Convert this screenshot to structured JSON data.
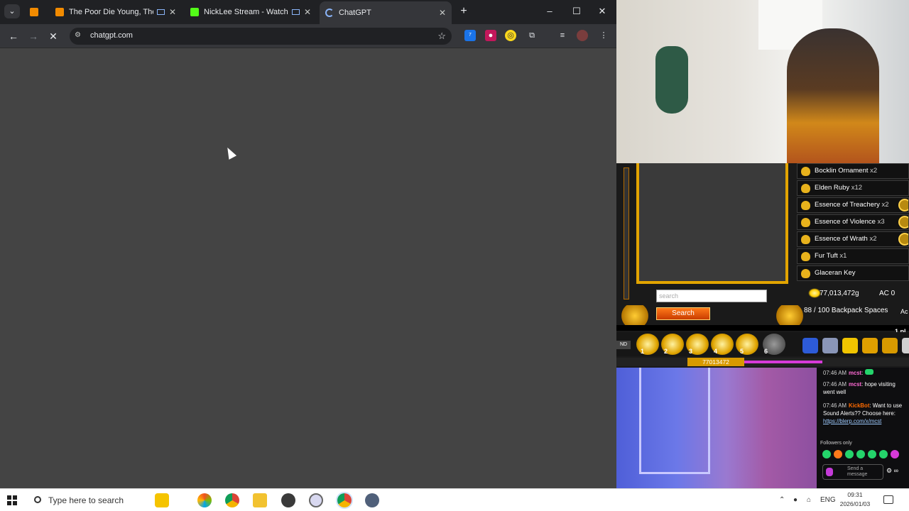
{
  "browser": {
    "tabs": [
      {
        "title": "",
        "favicon_color": "#f28b00"
      },
      {
        "title": "The Poor Die Young, The Ri",
        "favicon_color": "#f28b00"
      },
      {
        "title": "NickLee Stream - Watch Liv",
        "favicon_color": "#53fc18"
      },
      {
        "title": "ChatGPT",
        "favicon_color": "#8ab4f8"
      }
    ],
    "new_tab": "+",
    "url": "chatgpt.com",
    "window_controls": {
      "minimize": "–",
      "maximize": "☐",
      "close": "✕"
    }
  },
  "game": {
    "inventory": [
      {
        "name": "Bocklin Ornament",
        "qty": "x2"
      },
      {
        "name": "Elden Ruby",
        "qty": "x12"
      },
      {
        "name": "Essence of Treachery",
        "qty": "x2"
      },
      {
        "name": "Essence of Violence",
        "qty": "x3"
      },
      {
        "name": "Essence of Wrath",
        "qty": "x2"
      },
      {
        "name": "Fur Tuft",
        "qty": "x1"
      },
      {
        "name": "Glaceran Key",
        "qty": ""
      }
    ],
    "search_placeholder": "search",
    "search_button": "Search",
    "gold": "77,013,472g",
    "ac": "AC 0",
    "backpack": "88 / 100 Backpack Spaces",
    "ac_short": "Ac",
    "players": "1 pl",
    "hotbar_numbers": [
      "1",
      "2",
      "3",
      "4",
      "5",
      "6"
    ],
    "gold_bar": "77013472",
    "nd_label": "ND"
  },
  "chat": {
    "messages": [
      {
        "time": "07:46 AM",
        "user": "mcst",
        "text": "",
        "user_color": "#ff6ad5"
      },
      {
        "time": "07:46 AM",
        "user": "mcst",
        "text": "hope visiting went well",
        "user_color": "#ff6ad5"
      },
      {
        "time": "07:46 AM",
        "user": "KickBot",
        "text": "Want to use Sound Alerts?? Choose here:",
        "link": "https://blerp.com/x/mcst",
        "user_color": "#ff6a00"
      }
    ],
    "followers_only": "Followers only",
    "input_placeholder": "Send a message"
  },
  "taskbar": {
    "search_placeholder": "Type here to search",
    "language": "ENG",
    "time": "09:31",
    "date": "2026/01/03"
  }
}
